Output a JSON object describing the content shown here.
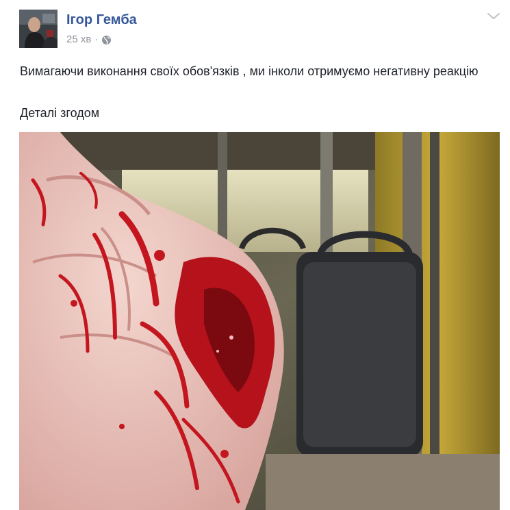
{
  "post": {
    "author_name": "Ігор Гемба",
    "timestamp": "25 хв",
    "separator": "·",
    "privacy_icon": "globe-icon",
    "options_icon": "chevron-down-icon",
    "text_line1": "Вимагаючи виконання своїх обов'язків , ми інколи отримуємо негативну реакцію",
    "text_line2": "Деталі згодом"
  },
  "colors": {
    "author_link": "#365899",
    "meta_text": "#90949c",
    "body_text": "#1d2129",
    "blood": "#b5121b"
  }
}
